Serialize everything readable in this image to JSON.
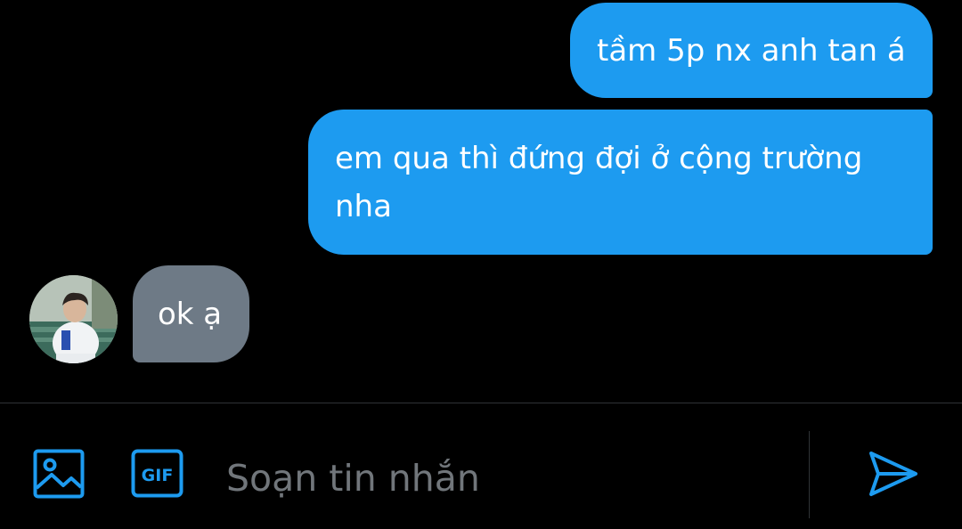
{
  "messages": [
    {
      "direction": "outgoing",
      "text": "tầm 5p nx anh tan á"
    },
    {
      "direction": "outgoing",
      "text": "em qua thì đứng đợi ở cộng trường nha"
    },
    {
      "direction": "incoming",
      "text": "ok ạ"
    }
  ],
  "composer": {
    "placeholder": "Soạn tin nhắn",
    "gif_label": "GIF"
  },
  "colors": {
    "outgoing_bubble": "#1d9bf0",
    "incoming_bubble": "#6e7a86",
    "accent": "#1d9bf0",
    "background": "#000000",
    "placeholder": "#71767b"
  },
  "icons": {
    "image": "image-icon",
    "gif": "gif-icon",
    "send": "send-icon"
  }
}
